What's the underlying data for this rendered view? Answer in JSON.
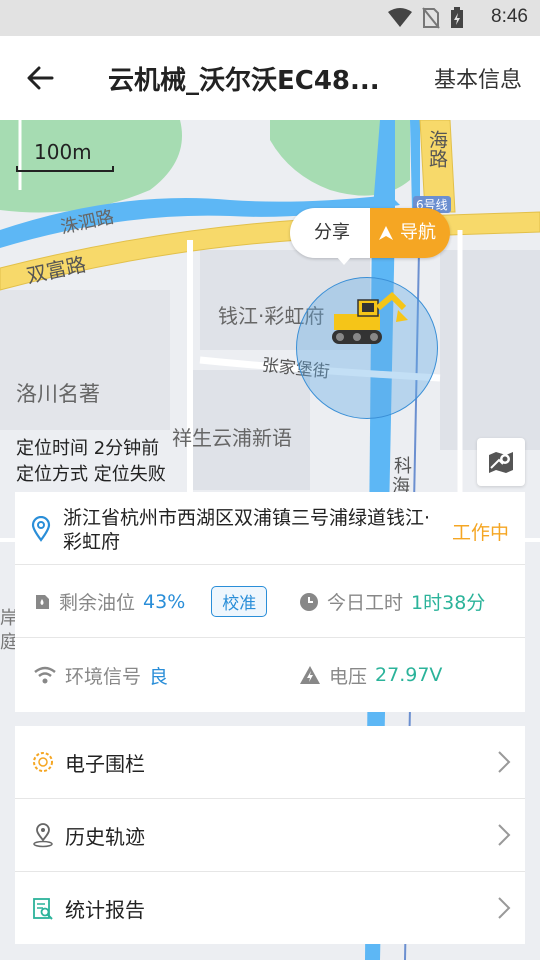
{
  "status_bar": {
    "time": "8:46"
  },
  "header": {
    "title": "云机械_沃尔沃EC48...",
    "right_link": "基本信息"
  },
  "map": {
    "scale_label": "100m",
    "labels": {
      "road_zhusi": "洙泗路",
      "road_shuangfu": "双富路",
      "community": "钱江·彩虹府",
      "street_zhangjiabao": "张家堡街",
      "luochuan": "洛川名著",
      "xiangsheng": "祥生云浦新语",
      "road_hai": "海路",
      "road_6": "6号线",
      "road_ke": "科",
      "road_hai2": "海",
      "side_an": "岸",
      "side_ting": "庭"
    },
    "popup": {
      "share": "分享",
      "navigate": "导航"
    },
    "location_time": "定位时间 2分钟前",
    "location_method": "定位方式 定位失败"
  },
  "info": {
    "address": "浙江省杭州市西湖区双浦镇三号浦绿道钱江·彩虹府",
    "work_status": "工作中",
    "fuel_label": "剩余油位",
    "fuel_value": "43%",
    "calibrate_label": "校准",
    "work_today_label": "今日工时",
    "work_today_value": "1时38分",
    "signal_label": "环境信号",
    "signal_value": "良",
    "voltage_label": "电压",
    "voltage_value": "27.97V"
  },
  "menu": [
    {
      "label": "电子围栏",
      "icon": "geofence-icon"
    },
    {
      "label": "历史轨迹",
      "icon": "track-pin-icon"
    },
    {
      "label": "统计报告",
      "icon": "report-icon"
    }
  ],
  "colors": {
    "accent_orange": "#f5a623",
    "blue": "#2a8ed8",
    "green": "#2bb39a",
    "map_green": "#a6dcb2",
    "map_water": "#5db7f5",
    "road_yellow": "#f7d96a"
  }
}
